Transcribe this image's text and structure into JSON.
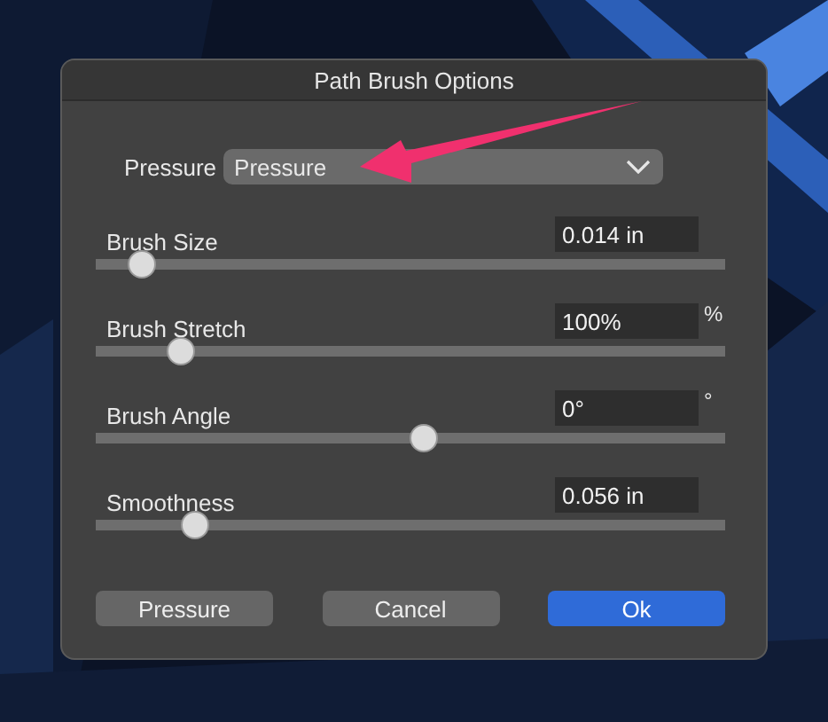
{
  "window": {
    "title": "Path Brush Options"
  },
  "pressure": {
    "label": "Pressure",
    "value": "Pressure"
  },
  "sliders": [
    {
      "label": "Brush Size",
      "value": "0.014 in",
      "level": 0.054
    },
    {
      "label": "Brush Stretch",
      "value": "100%",
      "unit": "%",
      "level": 0.115
    },
    {
      "label": "Brush Angle",
      "value": "0°",
      "unit": "°",
      "level": 0.5
    },
    {
      "label": "Smoothness",
      "value": "0.056 in",
      "level": 0.138
    }
  ],
  "buttons": [
    {
      "label": "Pressure",
      "default": false
    },
    {
      "label": "Cancel",
      "default": false
    },
    {
      "label": "Ok",
      "default": true
    }
  ]
}
